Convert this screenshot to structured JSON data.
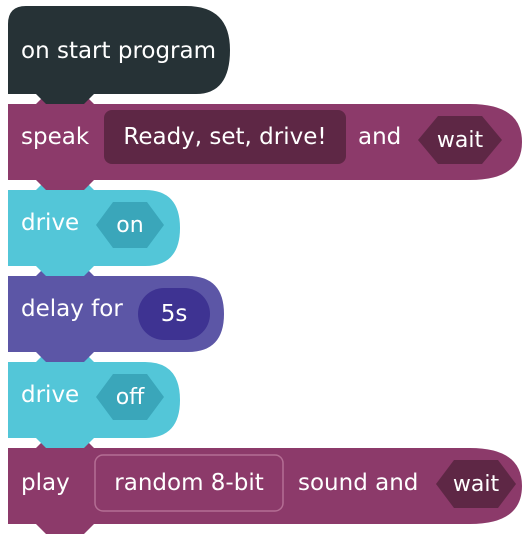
{
  "colors": {
    "start": "#263236",
    "speak": "#8c3a6a",
    "speak_slot": "#5e2745",
    "drive": "#53c6d8",
    "drive_hex": "#3aa6ba",
    "delay": "#5c56a6",
    "delay_pill": "#3e3392",
    "play": "#8c3a6a",
    "play_slot_border": "#b46e94"
  },
  "blocks": {
    "start": {
      "label": "on start program"
    },
    "speak": {
      "label": "speak",
      "text": "Ready, set, drive!",
      "and": "and",
      "wait": "wait"
    },
    "drive_on": {
      "label": "drive",
      "value": "on"
    },
    "delay": {
      "label": "delay for",
      "value": "5s"
    },
    "drive_off": {
      "label": "drive",
      "value": "off"
    },
    "play": {
      "label": "play",
      "sound": "random 8-bit",
      "suffix": "sound and",
      "wait": "wait"
    }
  }
}
